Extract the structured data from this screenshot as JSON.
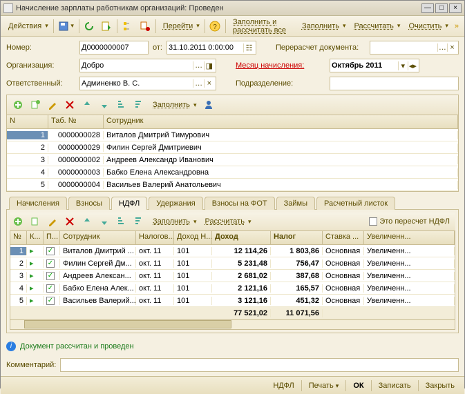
{
  "window": {
    "title": "Начисление зарплаты работникам организаций: Проведен"
  },
  "toolbar": {
    "actions": "Действия",
    "goto": "Перейти",
    "fill_calc_all": "Заполнить и рассчитать все",
    "fill": "Заполнить",
    "calc": "Рассчитать",
    "clear": "Очистить"
  },
  "form": {
    "number_label": "Номер:",
    "number": "Д0000000007",
    "from_label": "от:",
    "date": "31.10.2011 0:00:00",
    "recalc_label": "Перерасчет документа:",
    "recalc": "",
    "org_label": "Организация:",
    "org": "Добро",
    "month_label": "Месяц начисления:",
    "month": "Октябрь 2011",
    "resp_label": "Ответственный:",
    "resp": "Админенко В. С.",
    "dept_label": "Подразделение:",
    "dept": ""
  },
  "mini_tb": {
    "fill": "Заполнить"
  },
  "grid1": {
    "cols": {
      "n": "N",
      "tab": "Таб. №",
      "emp": "Сотрудник"
    },
    "rows": [
      {
        "n": "1",
        "tab": "0000000028",
        "emp": "Виталов Дмитрий Тимурович"
      },
      {
        "n": "2",
        "tab": "0000000029",
        "emp": "Филин Сергей Дмитриевич"
      },
      {
        "n": "3",
        "tab": "0000000002",
        "emp": "Андреев Александр Иванович"
      },
      {
        "n": "4",
        "tab": "0000000003",
        "emp": "Бабко Елена Александровна"
      },
      {
        "n": "5",
        "tab": "0000000004",
        "emp": "Васильев Валерий Анатольевич"
      }
    ]
  },
  "tabs": {
    "items": [
      "Начисления",
      "Взносы",
      "НДФЛ",
      "Удержания",
      "Взносы на ФОТ",
      "Займы",
      "Расчетный листок"
    ],
    "active": 2
  },
  "tab_tb": {
    "fill": "Заполнить",
    "calc": "Рассчитать",
    "recalc_chk": "Это пересчет НДФЛ"
  },
  "grid2": {
    "cols": {
      "n": "№",
      "k": "К...",
      "p": "П...",
      "emp": "Сотрудник",
      "tax": "Налогов...",
      "code": "Доход Н...",
      "income": "Доход",
      "ntax": "Налог",
      "rate": "Ставка ...",
      "inc": "Увеличенн..."
    },
    "rows": [
      {
        "n": "1",
        "emp": "Виталов Дмитрий ...",
        "tax": "окт. 11",
        "code": "101",
        "income": "12 114,26",
        "ntax": "1 803,86",
        "rate": "Основная",
        "inc": "Увеличенн..."
      },
      {
        "n": "2",
        "emp": "Филин Сергей Дм...",
        "tax": "окт. 11",
        "code": "101",
        "income": "5 231,48",
        "ntax": "756,47",
        "rate": "Основная",
        "inc": "Увеличенн..."
      },
      {
        "n": "3",
        "emp": "Андреев Алексан...",
        "tax": "окт. 11",
        "code": "101",
        "income": "2 681,02",
        "ntax": "387,68",
        "rate": "Основная",
        "inc": "Увеличенн..."
      },
      {
        "n": "4",
        "emp": "Бабко Елена Алек...",
        "tax": "окт. 11",
        "code": "101",
        "income": "2 121,16",
        "ntax": "165,57",
        "rate": "Основная",
        "inc": "Увеличенн..."
      },
      {
        "n": "5",
        "emp": "Васильев Валерий...",
        "tax": "окт. 11",
        "code": "101",
        "income": "3 121,16",
        "ntax": "451,32",
        "rate": "Основная",
        "inc": "Увеличенн..."
      }
    ],
    "totals": {
      "income": "77 521,02",
      "ntax": "11 071,56"
    }
  },
  "status": "Документ рассчитан и проведен",
  "comment_label": "Комментарий:",
  "bottom": {
    "ndfl": "НДФЛ",
    "print": "Печать",
    "ok": "ОК",
    "write": "Записать",
    "close": "Закрыть"
  }
}
